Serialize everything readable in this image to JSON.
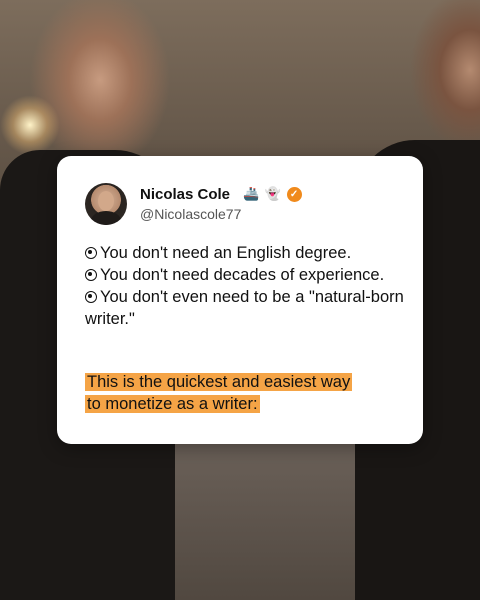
{
  "profile": {
    "name": "Nicolas Cole",
    "handle": "@Nicolascole77",
    "badges": [
      "🚢",
      "👻"
    ]
  },
  "bullets": [
    "You don't need an English degree.",
    "You don't need decades of experience.",
    "You don't even need to be a \"natural-born writer.\""
  ],
  "highlight": {
    "line1": "This is the quickest and easiest way",
    "line2": "to monetize as a writer:"
  },
  "colors": {
    "highlight": "#f5a446",
    "verified": "#f08a1c"
  }
}
